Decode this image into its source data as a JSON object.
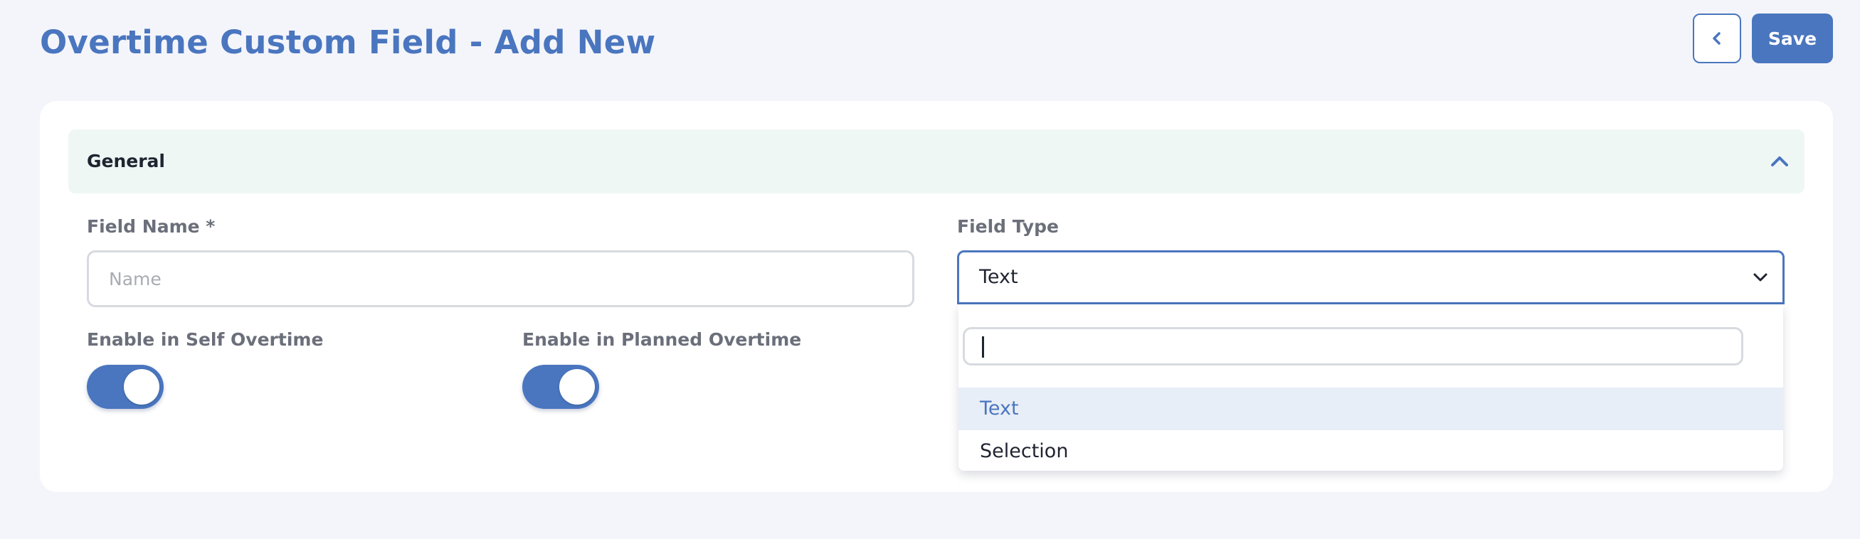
{
  "header": {
    "title": "Overtime Custom Field - Add New",
    "back_icon": "chevron-left-icon",
    "save_label": "Save"
  },
  "section": {
    "title": "General",
    "collapse_icon": "chevron-up-icon"
  },
  "form": {
    "field_name": {
      "label": "Field Name *",
      "placeholder": "Name",
      "value": ""
    },
    "field_type": {
      "label": "Field Type",
      "selected": "Text",
      "icon": "chevron-down-icon",
      "search_value": "",
      "options": [
        {
          "label": "Text",
          "active": true
        },
        {
          "label": "Selection",
          "active": false
        }
      ]
    },
    "toggles": [
      {
        "label": "Enable in Self Overtime",
        "on": true
      },
      {
        "label": "Enable in Planned Overtime",
        "on": true
      }
    ]
  },
  "colors": {
    "accent": "#4a76bf",
    "page_background": "#f4f5fa",
    "section_header_background": "#eff7f5",
    "option_highlight": "#e8eef7",
    "label_text": "#6b6f7a"
  }
}
